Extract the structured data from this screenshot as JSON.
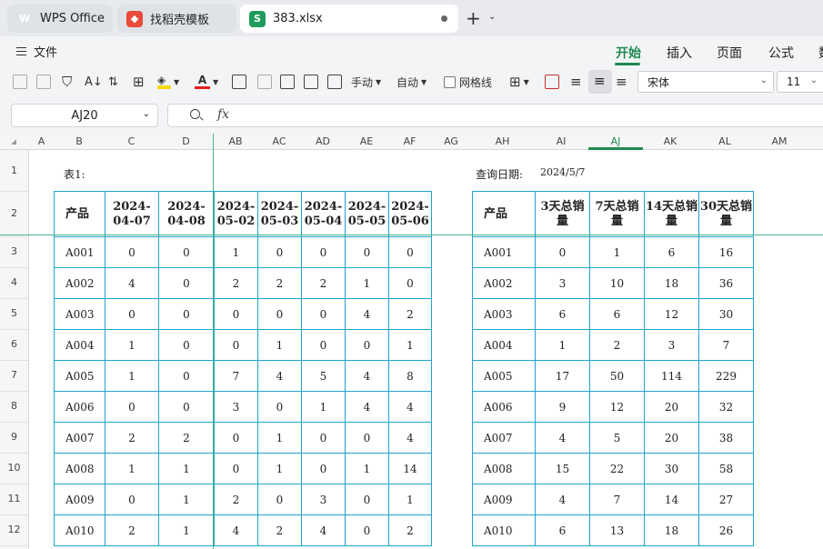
{
  "tabs": [
    {
      "label": "WPS Office",
      "icon": "wps-logo-icon"
    },
    {
      "label": "找稻壳模板",
      "icon": "daoke-logo-icon"
    },
    {
      "label": "383.xlsx",
      "icon": "xlsx-file-icon"
    }
  ],
  "menu": {
    "file_label": "文件",
    "ribbon_tabs": [
      "开始",
      "插入",
      "页面",
      "公式",
      "数"
    ]
  },
  "toolbar": {
    "manual_label": "手动",
    "auto_label": "自动",
    "gridlines_label": "网格线",
    "font_name": "宋体",
    "font_size": "11"
  },
  "formula_bar": {
    "name_box": "AJ20",
    "fx_label": "fx",
    "formula_value": ""
  },
  "columns": [
    {
      "label": "A",
      "w": 27
    },
    {
      "label": "B",
      "w": 56
    },
    {
      "label": "C",
      "w": 59
    },
    {
      "label": "D",
      "w": 61
    },
    {
      "label": "AB",
      "w": 48
    },
    {
      "label": "AC",
      "w": 48
    },
    {
      "label": "AD",
      "w": 48
    },
    {
      "label": "AE",
      "w": 48
    },
    {
      "label": "AF",
      "w": 47
    },
    {
      "label": "AG",
      "w": 44
    },
    {
      "label": "AH",
      "w": 69
    },
    {
      "label": "AI",
      "w": 60
    },
    {
      "label": "AJ",
      "w": 60
    },
    {
      "label": "AK",
      "w": 60
    },
    {
      "label": "AL",
      "w": 60
    },
    {
      "label": "AM",
      "w": 60
    }
  ],
  "selected_column": "AJ",
  "rows": [
    "1",
    "2",
    "3",
    "4",
    "5",
    "6",
    "7",
    "8",
    "9",
    "10",
    "11",
    "12"
  ],
  "sheet": {
    "table1_label": "表1:",
    "query_date_label": "查询日期:",
    "query_date_value": "2024/5/7",
    "table1": {
      "headers": [
        "产品",
        "2024-04-07",
        "2024-04-08",
        "2024-05-02",
        "2024-05-03",
        "2024-05-04",
        "2024-05-05",
        "2024-05-06"
      ],
      "rows": [
        [
          "A001",
          "0",
          "0",
          "1",
          "0",
          "0",
          "0",
          "0"
        ],
        [
          "A002",
          "4",
          "0",
          "2",
          "2",
          "2",
          "1",
          "0"
        ],
        [
          "A003",
          "0",
          "0",
          "0",
          "0",
          "0",
          "4",
          "2"
        ],
        [
          "A004",
          "1",
          "0",
          "0",
          "1",
          "0",
          "0",
          "1"
        ],
        [
          "A005",
          "1",
          "0",
          "7",
          "4",
          "5",
          "4",
          "8"
        ],
        [
          "A006",
          "0",
          "0",
          "3",
          "0",
          "1",
          "4",
          "4"
        ],
        [
          "A007",
          "2",
          "2",
          "0",
          "1",
          "0",
          "0",
          "4"
        ],
        [
          "A008",
          "1",
          "1",
          "0",
          "1",
          "0",
          "1",
          "14"
        ],
        [
          "A009",
          "0",
          "1",
          "2",
          "0",
          "3",
          "0",
          "1"
        ],
        [
          "A010",
          "2",
          "1",
          "4",
          "2",
          "4",
          "0",
          "2"
        ]
      ]
    },
    "table2": {
      "headers": [
        "产品",
        "3天总销量",
        "7天总销量",
        "14天总销量",
        "30天总销量"
      ],
      "rows": [
        [
          "A001",
          "0",
          "1",
          "6",
          "16"
        ],
        [
          "A002",
          "3",
          "10",
          "18",
          "36"
        ],
        [
          "A003",
          "6",
          "6",
          "12",
          "30"
        ],
        [
          "A004",
          "1",
          "2",
          "3",
          "7"
        ],
        [
          "A005",
          "17",
          "50",
          "114",
          "229"
        ],
        [
          "A006",
          "9",
          "12",
          "20",
          "32"
        ],
        [
          "A007",
          "4",
          "5",
          "20",
          "38"
        ],
        [
          "A008",
          "15",
          "22",
          "30",
          "58"
        ],
        [
          "A009",
          "4",
          "7",
          "14",
          "27"
        ],
        [
          "A010",
          "6",
          "13",
          "18",
          "26"
        ]
      ]
    }
  },
  "colors": {
    "accent": "#1d8a4f",
    "table_border": "#1fa3cf",
    "freeze_line": "#43b38a"
  }
}
